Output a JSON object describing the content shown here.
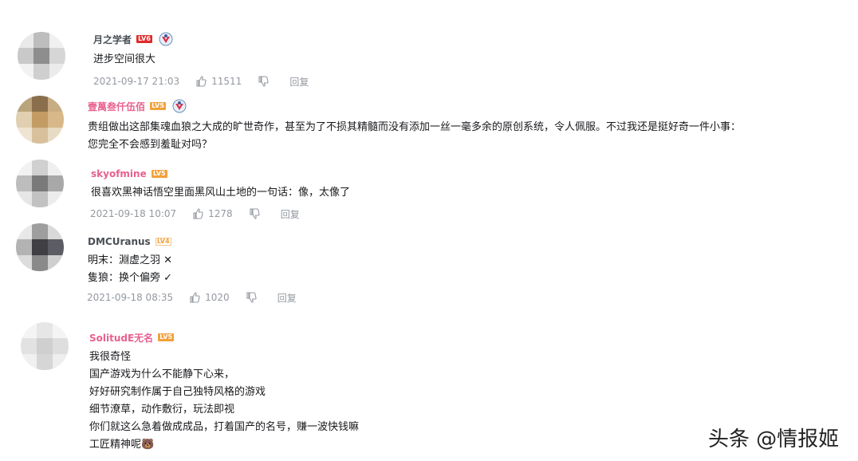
{
  "colors": {
    "name_dark": "#4a4f56",
    "name_pink": "#e8608f",
    "meta_gray": "#9499a0",
    "level_red": "#e02b2b",
    "level_orange": "#f3a03a"
  },
  "comments": [
    {
      "username": "月之学者",
      "level": "LV6",
      "has_medal": true,
      "text": "进步空间很大",
      "time": "2021-09-17 21:03",
      "likes": "11511",
      "reply_label": "回复"
    },
    {
      "username": "壹萬叁仟伍佰",
      "level": "LV5",
      "has_medal": true,
      "text": "贵组做出这部集魂血狼之大成的旷世奇作，甚至为了不损其精髓而没有添加一丝一毫多余的原创系统，令人佩服。不过我还是挺好奇一件小事：\n您完全不会感到羞耻对吗？"
    },
    {
      "username": "skyofmine",
      "level": "LV5",
      "text": "很喜欢黑神话悟空里面黑风山土地的一句话：像，太像了",
      "time": "2021-09-18 10:07",
      "likes": "1278",
      "reply_label": "回复"
    },
    {
      "username": "DMCUranus",
      "level": "LV4",
      "text": "明末：淵虚之羽 ✕\n隻狼：换个偏旁 ✓",
      "time": "2021-09-18 08:35",
      "likes": "1020",
      "reply_label": "回复"
    },
    {
      "username": "SolitudE无名",
      "level": "LV5",
      "text": "我很奇怪\n国产游戏为什么不能静下心来，\n好好研究制作属于自己独特风格的游戏\n细节潦草，动作敷衍，玩法即视\n你们就这么急着做成成品，打着国产的名号，赚一波快钱嘛\n工匠精神呢🐻"
    }
  ],
  "watermark": "头条 @情报姬"
}
